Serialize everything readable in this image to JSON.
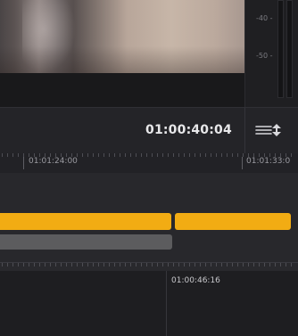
{
  "meters": {
    "label_40": "-40 -",
    "label_50": "-50 -"
  },
  "toolbar": {
    "timecode": "01:00:40:04",
    "track_height_icon": "track-height-icon"
  },
  "ruler": {
    "label_1": "01:01:24:00",
    "label_2": "01:01:33:0"
  },
  "lower": {
    "timecode": "01:00:46:16"
  },
  "colors": {
    "video_clip": "#f2ac13",
    "audio_clip": "#5c5c5e",
    "timecode": "#e8e8ea"
  }
}
